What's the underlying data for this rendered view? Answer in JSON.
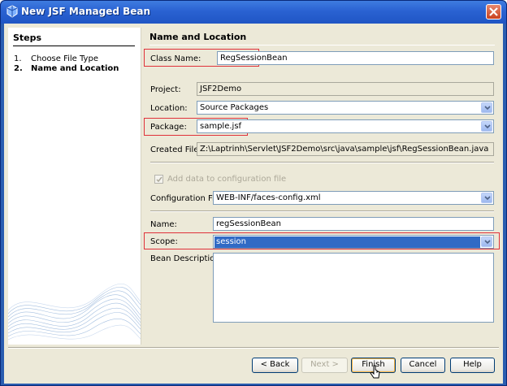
{
  "window": {
    "title": "New JSF Managed Bean",
    "icons": {
      "app": "bean-icon",
      "close": "close-icon"
    }
  },
  "steps": {
    "title": "Steps",
    "items": [
      {
        "num": "1.",
        "label": "Choose File Type",
        "current": false
      },
      {
        "num": "2.",
        "label": "Name and Location",
        "current": true
      }
    ]
  },
  "form": {
    "section_title": "Name and Location",
    "class_name": {
      "label": "Class Name:",
      "value": "RegSessionBean"
    },
    "project": {
      "label": "Project:",
      "value": "JSF2Demo"
    },
    "location": {
      "label": "Location:",
      "value": "Source Packages"
    },
    "package": {
      "label": "Package:",
      "value": "sample.jsf"
    },
    "created_file": {
      "label": "Created File:",
      "value": "Z:\\Laptrinh\\Servlet\\JSF2Demo\\src\\java\\sample\\jsf\\RegSessionBean.java"
    },
    "add_config": {
      "label": "Add data to configuration file",
      "checked": true,
      "enabled": false
    },
    "config_file": {
      "label": "Configuration File:",
      "value": "WEB-INF/faces-config.xml"
    },
    "name": {
      "label": "Name:",
      "value": "regSessionBean"
    },
    "scope": {
      "label": "Scope:",
      "value": "session"
    },
    "bean_description": {
      "label": "Bean Description:",
      "value": ""
    }
  },
  "buttons": {
    "back": "< Back",
    "next": "Next >",
    "finish": "Finish",
    "cancel": "Cancel",
    "help": "Help"
  },
  "colors": {
    "title_bar": "#2a62d2",
    "highlight": "#e0313a",
    "selection": "#316ac5",
    "dialog_bg": "#ece9d8"
  }
}
